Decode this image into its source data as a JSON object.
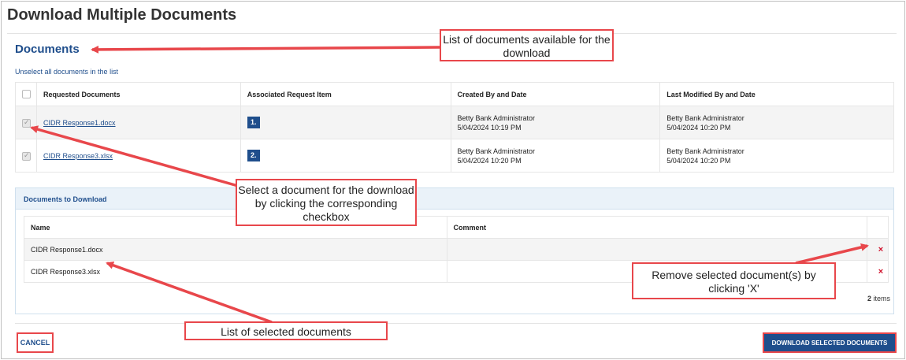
{
  "page": {
    "title": "Download Multiple Documents",
    "section_title": "Documents",
    "unselect_link": "Unselect all documents in the list"
  },
  "documents_table": {
    "headers": [
      "Requested Documents",
      "Associated Request Item",
      "Created By and Date",
      "Last Modified By and Date"
    ],
    "rows": [
      {
        "checked": true,
        "name": "CIDR Response1.docx",
        "request_item": "1.",
        "created_by": "Betty Bank Administrator",
        "created_date": "5/04/2024 10:19 PM",
        "modified_by": "Betty Bank Administrator",
        "modified_date": "5/04/2024 10:20 PM"
      },
      {
        "checked": true,
        "name": "CIDR Response3.xlsx",
        "request_item": "2.",
        "created_by": "Betty Bank Administrator",
        "created_date": "5/04/2024 10:20 PM",
        "modified_by": "Betty Bank Administrator",
        "modified_date": "5/04/2024 10:20 PM"
      }
    ]
  },
  "download_panel": {
    "title": "Documents to Download",
    "headers": [
      "Name",
      "Comment"
    ],
    "rows": [
      {
        "name": "CIDR Response1.docx",
        "comment": "",
        "remove_icon": "×"
      },
      {
        "name": "CIDR Response3.xlsx",
        "comment": "",
        "remove_icon": "×"
      }
    ],
    "count": "2",
    "count_label": "items"
  },
  "footer": {
    "cancel_label": "CANCEL",
    "download_label": "DOWNLOAD SELECTED DOCUMENTS"
  },
  "annotations": {
    "list_available": "List of documents available for the download",
    "select_document": "Select a document for the download by clicking the corresponding checkbox",
    "remove_selected": "Remove selected document(s) by clicking 'X'",
    "list_selected": "List of selected documents"
  },
  "colors": {
    "brand_blue": "#1f4e8c",
    "annotation_red": "#e8474b",
    "remove_red": "#d0112b"
  }
}
